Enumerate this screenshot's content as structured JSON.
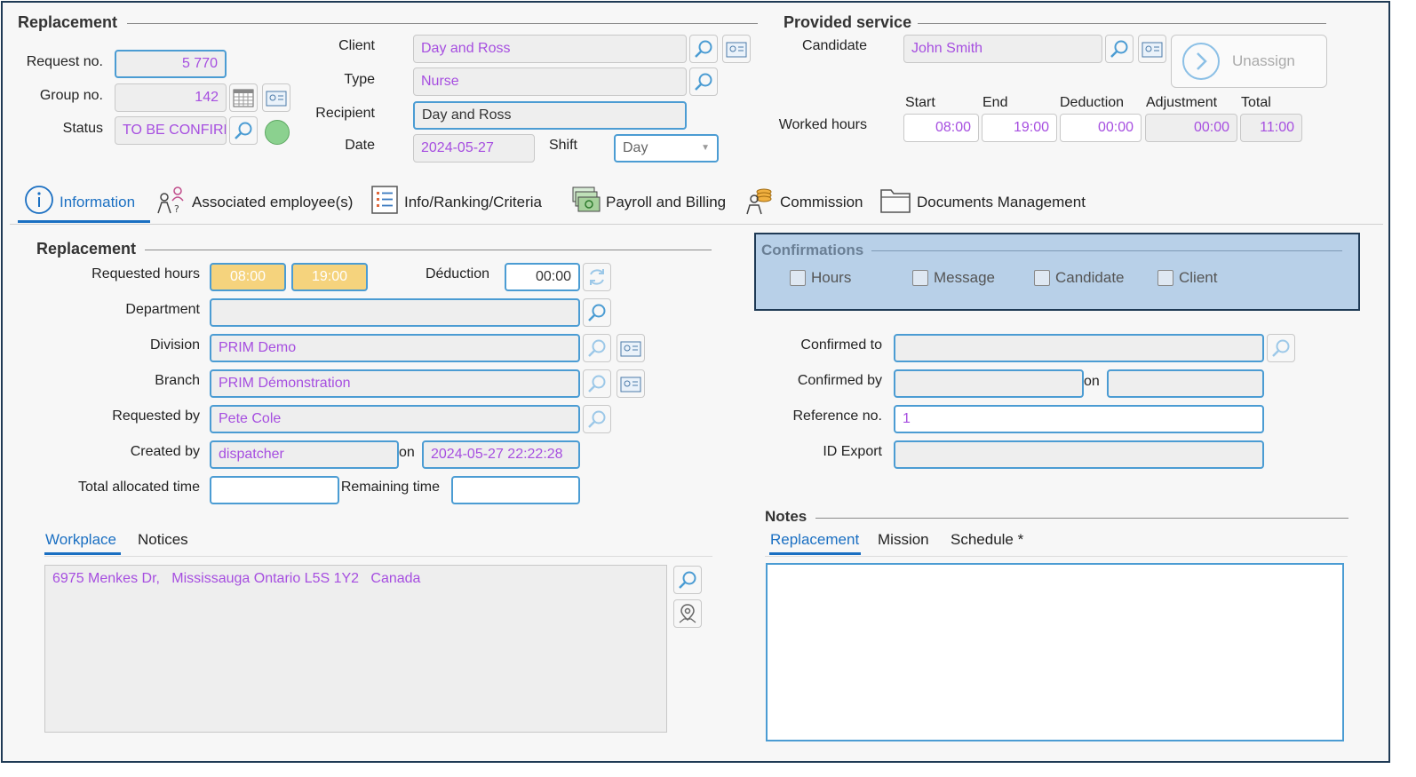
{
  "header": {
    "replacement_title": "Replacement",
    "provided_title": "Provided service",
    "request_no_label": "Request no.",
    "request_no": "5 770",
    "group_no_label": "Group no.",
    "group_no": "142",
    "status_label": "Status",
    "status": "TO BE CONFIRM",
    "status_color": "#8bd18f",
    "client_label": "Client",
    "client": "Day and Ross",
    "type_label": "Type",
    "type": "Nurse",
    "recipient_label": "Recipient",
    "recipient": "Day and Ross",
    "date_label": "Date",
    "date": "2024-05-27",
    "shift_label": "Shift",
    "shift": "Day",
    "candidate_label": "Candidate",
    "candidate": "John Smith",
    "unassign_label": "Unassign",
    "worked_hours_label": "Worked hours",
    "start_label": "Start",
    "start": "08:00",
    "end_label": "End",
    "end": "19:00",
    "deduction_label": "Deduction",
    "deduction": "00:00",
    "adjustment_label": "Adjustment",
    "adjustment": "00:00",
    "total_label": "Total",
    "total": "11:00"
  },
  "tabs": [
    {
      "label": "Information",
      "icon": "info-icon"
    },
    {
      "label": "Associated employee(s)",
      "icon": "employees-icon"
    },
    {
      "label": "Info/Ranking/Criteria",
      "icon": "list-icon"
    },
    {
      "label": "Payroll and Billing",
      "icon": "money-icon"
    },
    {
      "label": "Commission",
      "icon": "commission-icon"
    },
    {
      "label": "Documents Management",
      "icon": "folder-icon"
    }
  ],
  "replacement": {
    "title": "Replacement",
    "requested_hours_label": "Requested hours",
    "req_start": "08:00",
    "req_end": "19:00",
    "deduction_label": "Déduction",
    "deduction": "00:00",
    "department_label": "Department",
    "department": "",
    "division_label": "Division",
    "division": "PRIM Demo",
    "branch_label": "Branch",
    "branch": "PRIM Démonstration",
    "requested_by_label": "Requested by",
    "requested_by": "Pete Cole",
    "created_by_label": "Created by",
    "created_by": "dispatcher",
    "on_label": "on",
    "created_on": "2024-05-27 22:22:28",
    "total_alloc_label": "Total allocated time",
    "remaining_label": "Remaining time"
  },
  "confirmations": {
    "title": "Confirmations",
    "hours": "Hours",
    "message": "Message",
    "candidate": "Candidate",
    "client": "Client",
    "panel_color": "#b8d0e8"
  },
  "confirm_fields": {
    "confirmed_to_label": "Confirmed to",
    "confirmed_by_label": "Confirmed by",
    "on_label": "on",
    "reference_label": "Reference no.",
    "reference": "1",
    "id_export_label": "ID Export"
  },
  "workplace": {
    "tab_workplace": "Workplace",
    "tab_notices": "Notices",
    "address": "6975 Menkes Dr,   Mississauga Ontario L5S 1Y2   Canada"
  },
  "notes": {
    "title": "Notes",
    "tab_replacement": "Replacement",
    "tab_mission": "Mission",
    "tab_schedule": "Schedule *"
  }
}
